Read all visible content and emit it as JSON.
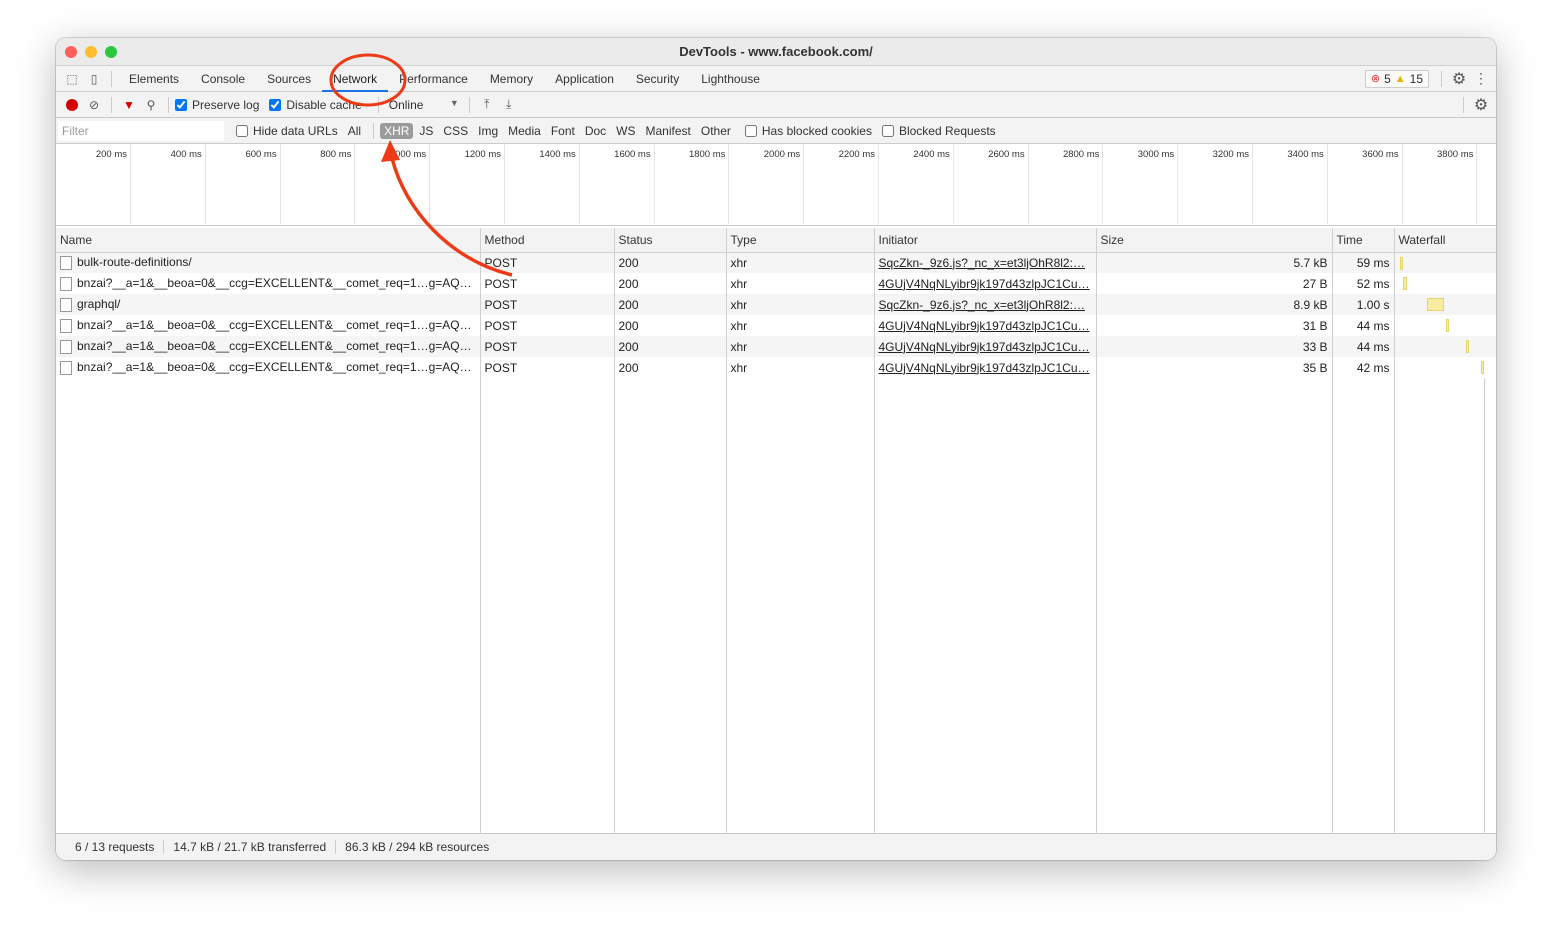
{
  "window": {
    "title": "DevTools - www.facebook.com/"
  },
  "tabs": [
    {
      "label": "Elements"
    },
    {
      "label": "Console"
    },
    {
      "label": "Sources"
    },
    {
      "label": "Network",
      "active": true
    },
    {
      "label": "Performance"
    },
    {
      "label": "Memory"
    },
    {
      "label": "Application"
    },
    {
      "label": "Security"
    },
    {
      "label": "Lighthouse"
    }
  ],
  "status": {
    "errors": "5",
    "warnings": "15"
  },
  "toolbar": {
    "preserve_log": "Preserve log",
    "disable_cache": "Disable cache",
    "throttle": "Online"
  },
  "filter": {
    "placeholder": "Filter",
    "hide_data_urls": "Hide data URLs",
    "types": [
      "All",
      "XHR",
      "JS",
      "CSS",
      "Img",
      "Media",
      "Font",
      "Doc",
      "WS",
      "Manifest",
      "Other"
    ],
    "selected": "XHR",
    "blocked_cookies": "Has blocked cookies",
    "blocked_requests": "Blocked Requests"
  },
  "overview": {
    "ticks": [
      "200 ms",
      "400 ms",
      "600 ms",
      "800 ms",
      "1000 ms",
      "1200 ms",
      "1400 ms",
      "1600 ms",
      "1800 ms",
      "2000 ms",
      "2200 ms",
      "2400 ms",
      "2600 ms",
      "2800 ms",
      "3000 ms",
      "3200 ms",
      "3400 ms",
      "3600 ms",
      "3800 ms"
    ]
  },
  "columns": [
    "Name",
    "Method",
    "Status",
    "Type",
    "Initiator",
    "Size",
    "Time",
    "Waterfall"
  ],
  "rows": [
    {
      "name": "bulk-route-definitions/",
      "method": "POST",
      "status": "200",
      "type": "xhr",
      "initiator": "SqcZkn-_9z6.js?_nc_x=et3ljOhR8l2:…",
      "size": "5.7 kB",
      "time": "59 ms"
    },
    {
      "name": "bnzai?__a=1&__beoa=0&__ccg=EXCELLENT&__comet_req=1…g=AQ…",
      "method": "POST",
      "status": "200",
      "type": "xhr",
      "initiator": "4GUjV4NqNLyibr9jk197d43zlpJC1Cu…",
      "size": "27 B",
      "time": "52 ms"
    },
    {
      "name": "graphql/",
      "method": "POST",
      "status": "200",
      "type": "xhr",
      "initiator": "SqcZkn-_9z6.js?_nc_x=et3ljOhR8l2:…",
      "size": "8.9 kB",
      "time": "1.00 s"
    },
    {
      "name": "bnzai?__a=1&__beoa=0&__ccg=EXCELLENT&__comet_req=1…g=AQ…",
      "method": "POST",
      "status": "200",
      "type": "xhr",
      "initiator": "4GUjV4NqNLyibr9jk197d43zlpJC1Cu…",
      "size": "31 B",
      "time": "44 ms"
    },
    {
      "name": "bnzai?__a=1&__beoa=0&__ccg=EXCELLENT&__comet_req=1…g=AQ…",
      "method": "POST",
      "status": "200",
      "type": "xhr",
      "initiator": "4GUjV4NqNLyibr9jk197d43zlpJC1Cu…",
      "size": "33 B",
      "time": "44 ms"
    },
    {
      "name": "bnzai?__a=1&__beoa=0&__ccg=EXCELLENT&__comet_req=1…g=AQ…",
      "method": "POST",
      "status": "200",
      "type": "xhr",
      "initiator": "4GUjV4NqNLyibr9jk197d43zlpJC1Cu…",
      "size": "35 B",
      "time": "42 ms"
    }
  ],
  "footer": {
    "requests": "6 / 13 requests",
    "transferred": "14.7 kB / 21.7 kB transferred",
    "resources": "86.3 kB / 294 kB resources"
  },
  "colors": {
    "accent": "#1a73e8",
    "annotation": "#f03a17",
    "record": "#d40000"
  }
}
